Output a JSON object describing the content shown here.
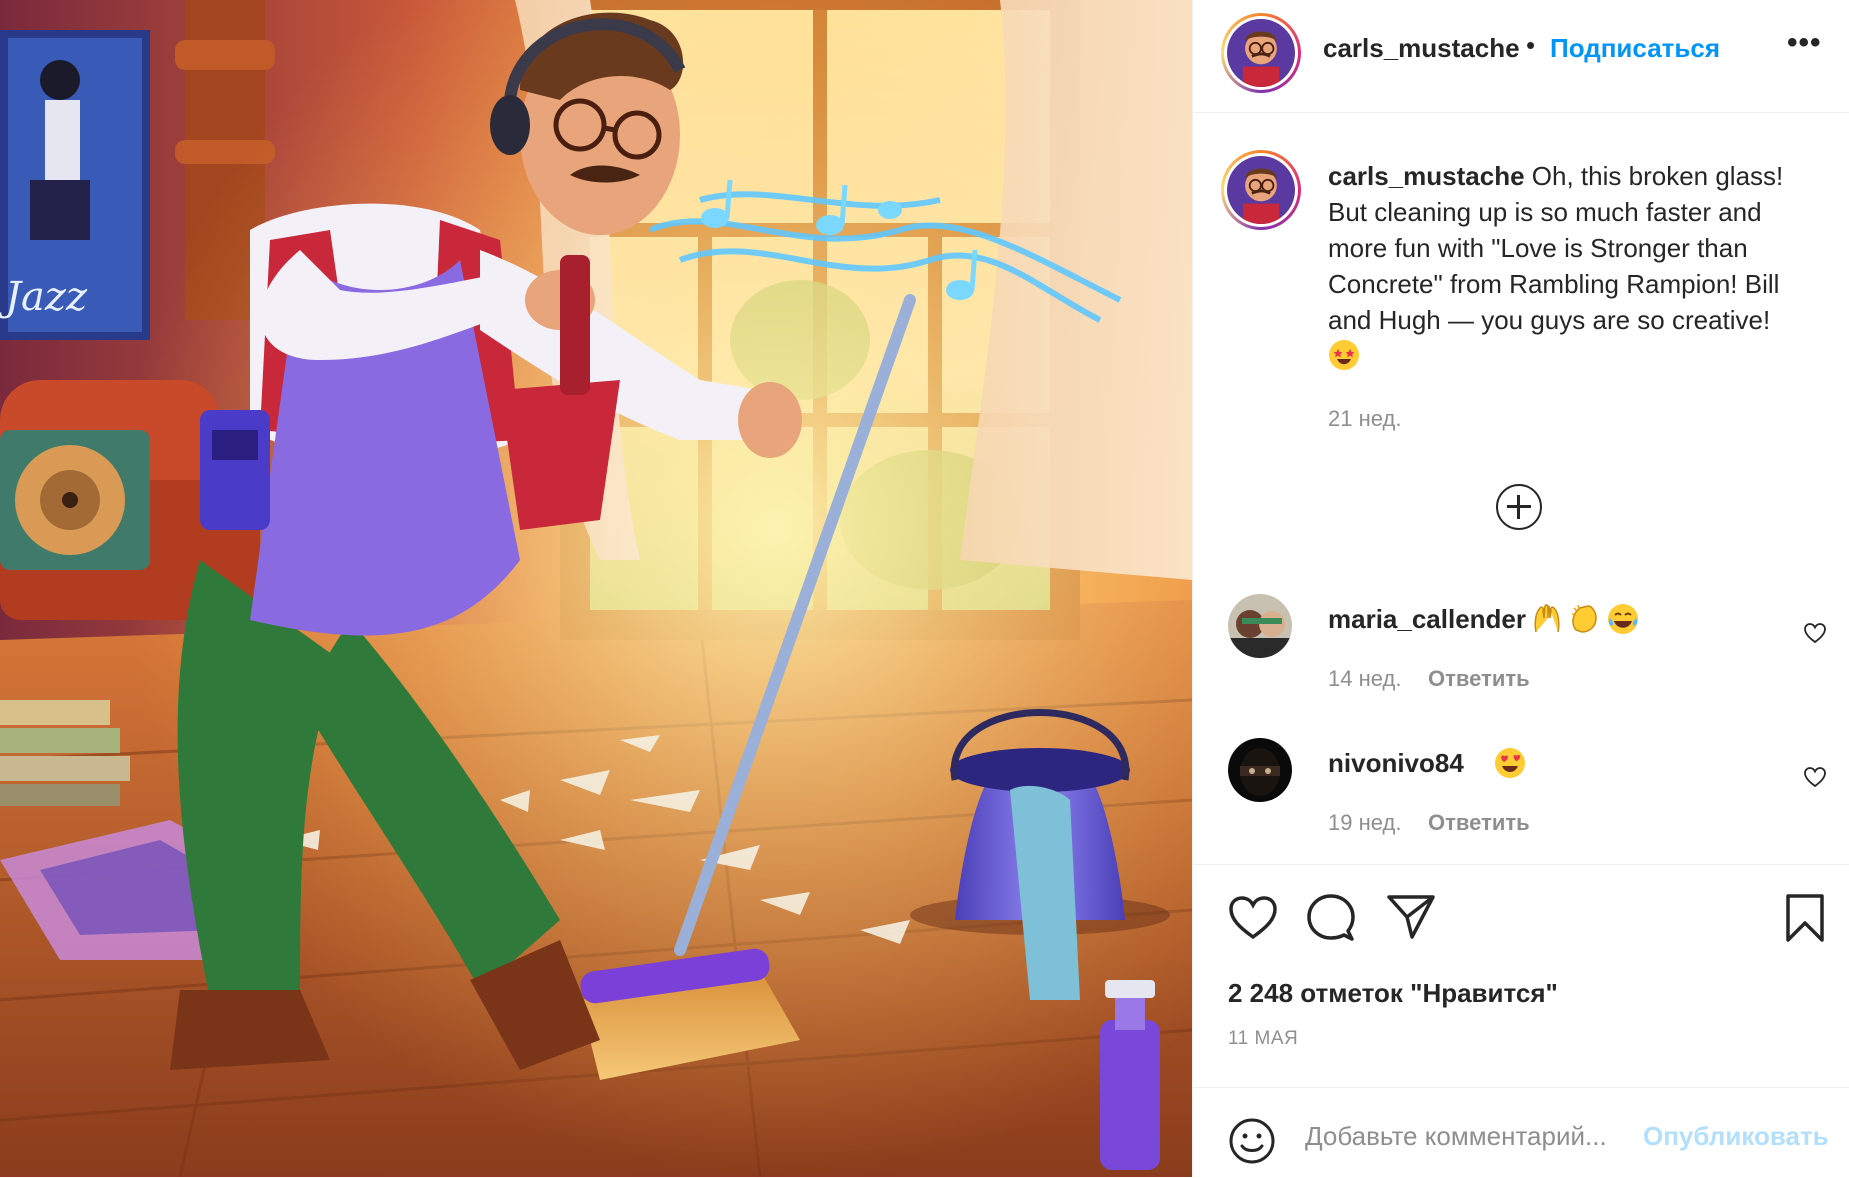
{
  "post": {
    "username": "carls_mustache",
    "separator": "•",
    "follow_label": "Подписаться",
    "more_label": "•••",
    "image_alt": "Illustration of a man with headphones sweeping broken glass",
    "poster_text": "Jazz"
  },
  "caption": {
    "username": "carls_mustache",
    "text": "Oh, this broken glass! But cleaning up is so much faster and more fun with \"Love is Stronger than Concrete\" from Rambling Rampion! Bill and Hugh — you guys are so creative!",
    "emojis": [
      "star-struck"
    ],
    "time": "21 нед."
  },
  "load_more_icon": "plus-circle-icon",
  "comments": [
    {
      "username": "maria_callender",
      "emojis": [
        "raising-hands",
        "clapping-hands",
        "tears-of-joy"
      ],
      "time": "14 нед.",
      "reply_label": "Ответить"
    },
    {
      "username": "nivonivo84",
      "emojis": [
        "heart-eyes"
      ],
      "time": "19 нед.",
      "reply_label": "Ответить"
    }
  ],
  "actions": {
    "icons": [
      "heart-icon",
      "comment-icon",
      "share-icon",
      "bookmark-icon"
    ],
    "likes": "2 248 отметок \"Нравится\"",
    "date": "11 МАЯ"
  },
  "add_comment": {
    "placeholder": "Добавьте комментарий...",
    "publish_label": "Опубликовать"
  },
  "colors": {
    "link": "#0095f6",
    "muted": "#8e8e8e",
    "text": "#262626",
    "publish_disabled": "#b2dffc"
  }
}
